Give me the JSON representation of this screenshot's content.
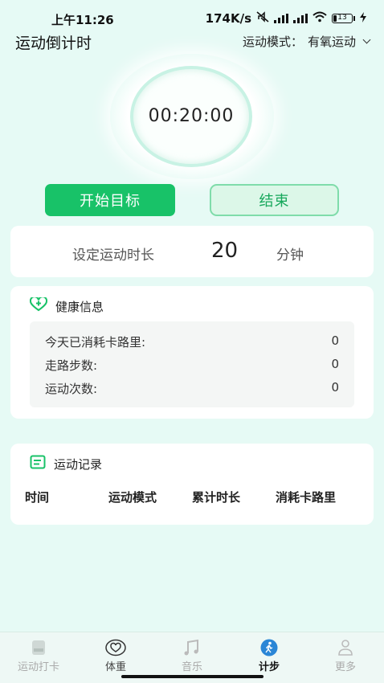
{
  "status_bar": {
    "time": "上午11:26",
    "speed": "174K/s",
    "battery": "13"
  },
  "header": {
    "title": "运动倒计时",
    "mode_label": "运动模式：",
    "mode_value": "有氧运动"
  },
  "timer": {
    "display": "00:20:00"
  },
  "buttons": {
    "start": "开始目标",
    "end": "结束"
  },
  "duration": {
    "label": "设定运动时长",
    "value": "20",
    "unit": "分钟"
  },
  "health": {
    "title": "健康信息",
    "rows": [
      {
        "label": "今天已消耗卡路里:",
        "value": "0"
      },
      {
        "label": "走路步数:",
        "value": "0"
      },
      {
        "label": "运动次数:",
        "value": "0"
      }
    ]
  },
  "records": {
    "title": "运动记录",
    "columns": [
      "时间",
      "运动模式",
      "累计时长",
      "消耗卡路里"
    ]
  },
  "nav": {
    "items": [
      {
        "label": "运动打卡",
        "icon": "shoe-icon"
      },
      {
        "label": "体重",
        "icon": "heart-icon"
      },
      {
        "label": "音乐",
        "icon": "music-note-icon"
      },
      {
        "label": "计步",
        "icon": "walking-icon",
        "active": true
      },
      {
        "label": "更多",
        "icon": "person-icon"
      }
    ]
  },
  "colors": {
    "background": "#e6faf5",
    "accent": "#18c268",
    "end_button_bg": "#dcf7e8"
  }
}
